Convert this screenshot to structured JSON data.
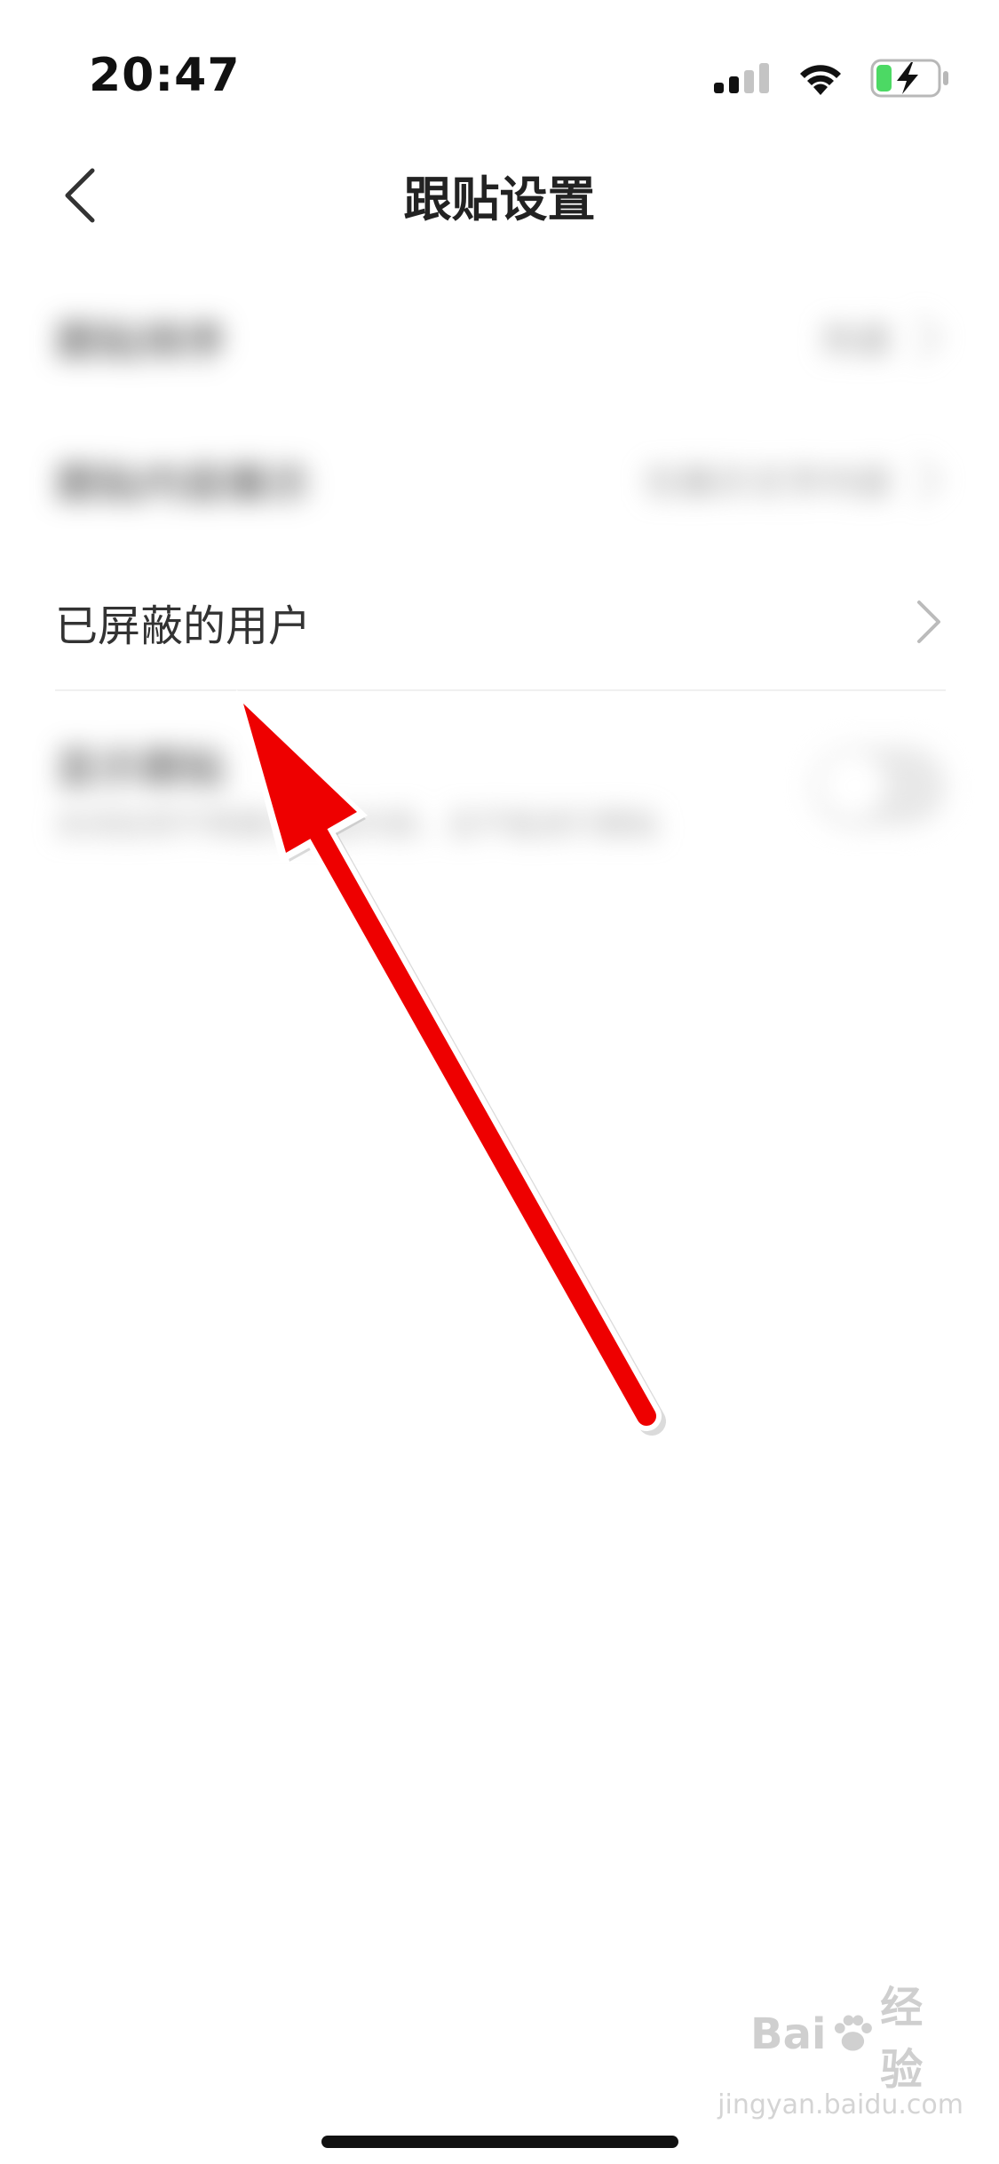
{
  "status_bar": {
    "time": "20:47"
  },
  "nav": {
    "title": "跟贴设置"
  },
  "settings": {
    "rows": [
      {
        "label": "跟贴排序",
        "value": "热度"
      },
      {
        "label": "跟贴内容展示",
        "value": "仅展示文字内容"
      },
      {
        "label": "已屏蔽的用户"
      },
      {
        "label": "显示跟贴",
        "subtitle": "关闭后将不再展示跟贴内容，且不能进行跟贴"
      }
    ]
  },
  "watermark": {
    "brand": "Bai",
    "suffix": "经验",
    "url": "jingyan.baidu.com"
  },
  "colors": {
    "arrow": "#ee0000",
    "text": "#333333",
    "chevron": "#bbbbbb",
    "battery": "#4cd964"
  }
}
